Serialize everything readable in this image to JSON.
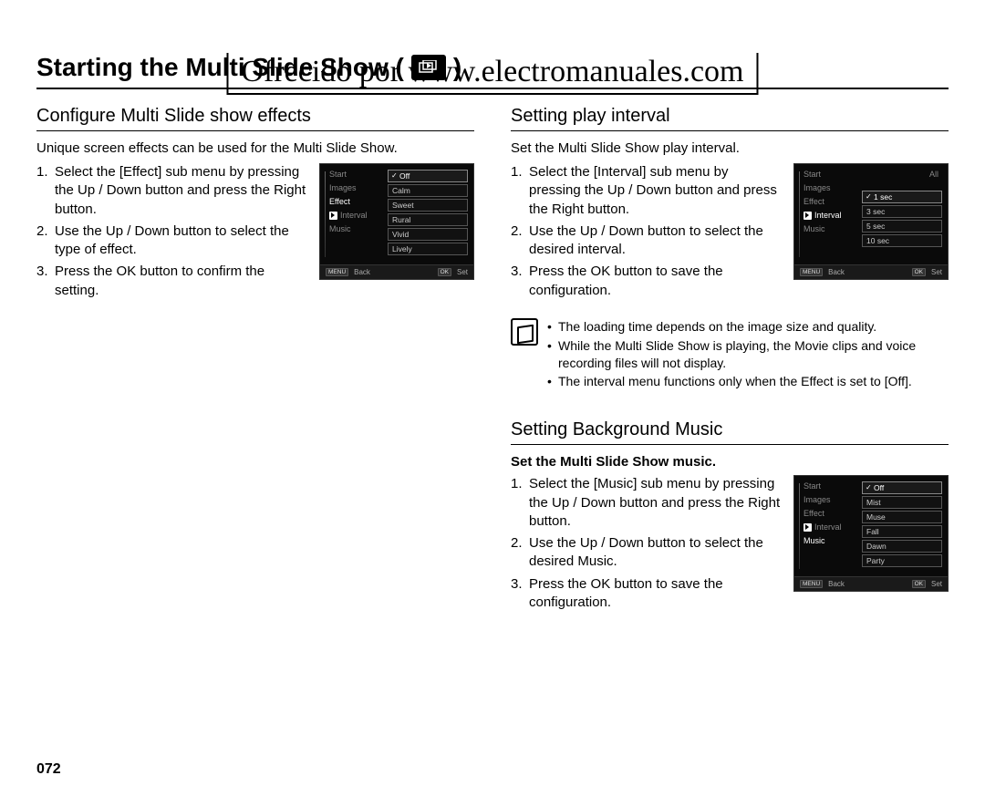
{
  "watermark": "Ofrecido por www.electromanuales.com",
  "page_title_prefix": "Starting the Multi Slide Show (",
  "page_title_suffix": ")",
  "page_number": "072",
  "left_column": {
    "heading": "Configure Multi Slide show effects",
    "intro": "Unique screen effects can be used for the Multi Slide Show.",
    "steps": [
      "Select the [Effect] sub menu by pressing the Up / Down button and press the Right button.",
      "Use the Up / Down button to select the type of effect.",
      "Press the OK button to confirm the setting."
    ],
    "screenshot": {
      "menu": [
        "Start",
        "Images",
        "Effect",
        "Interval",
        "Music"
      ],
      "selected_menu": "Effect",
      "options": [
        "Off",
        "Calm",
        "Sweet",
        "Rural",
        "Vivid",
        "Lively"
      ],
      "selected_option": "Off",
      "footer_left_btn": "MENU",
      "footer_left_label": "Back",
      "footer_right_btn": "OK",
      "footer_right_label": "Set"
    }
  },
  "right_column": {
    "section1": {
      "heading": "Setting play interval",
      "intro": "Set the Multi Slide Show play interval.",
      "steps": [
        "Select the [Interval] sub menu by pressing the Up / Down button and press the Right button.",
        "Use the Up / Down button to select the desired interval.",
        "Press the OK button to save the configuration."
      ],
      "screenshot": {
        "menu": [
          "Start",
          "Images",
          "Effect",
          "Interval",
          "Music"
        ],
        "selected_menu": "Interval",
        "right_value": "All",
        "options": [
          "1 sec",
          "3 sec",
          "5 sec",
          "10 sec"
        ],
        "selected_option": "1 sec",
        "footer_left_btn": "MENU",
        "footer_left_label": "Back",
        "footer_right_btn": "OK",
        "footer_right_label": "Set"
      }
    },
    "notes": [
      "The loading time depends on the image size and quality.",
      "While the Multi Slide Show is playing, the Movie clips and voice recording files will not display.",
      "The interval menu functions only when the Effect is set to [Off]."
    ],
    "section2": {
      "heading": "Setting Background Music",
      "intro_bold": "Set the Multi Slide Show music.",
      "steps": [
        "Select the [Music] sub menu by pressing the Up / Down button and press the Right button.",
        "Use the Up / Down button to select the desired Music.",
        "Press the OK button to save the configuration."
      ],
      "screenshot": {
        "menu": [
          "Start",
          "Images",
          "Effect",
          "Interval",
          "Music"
        ],
        "selected_menu": "Music",
        "options": [
          "Off",
          "Mist",
          "Muse",
          "Fall",
          "Dawn",
          "Party"
        ],
        "selected_option": "Off",
        "footer_left_btn": "MENU",
        "footer_left_label": "Back",
        "footer_right_btn": "OK",
        "footer_right_label": "Set"
      }
    }
  }
}
